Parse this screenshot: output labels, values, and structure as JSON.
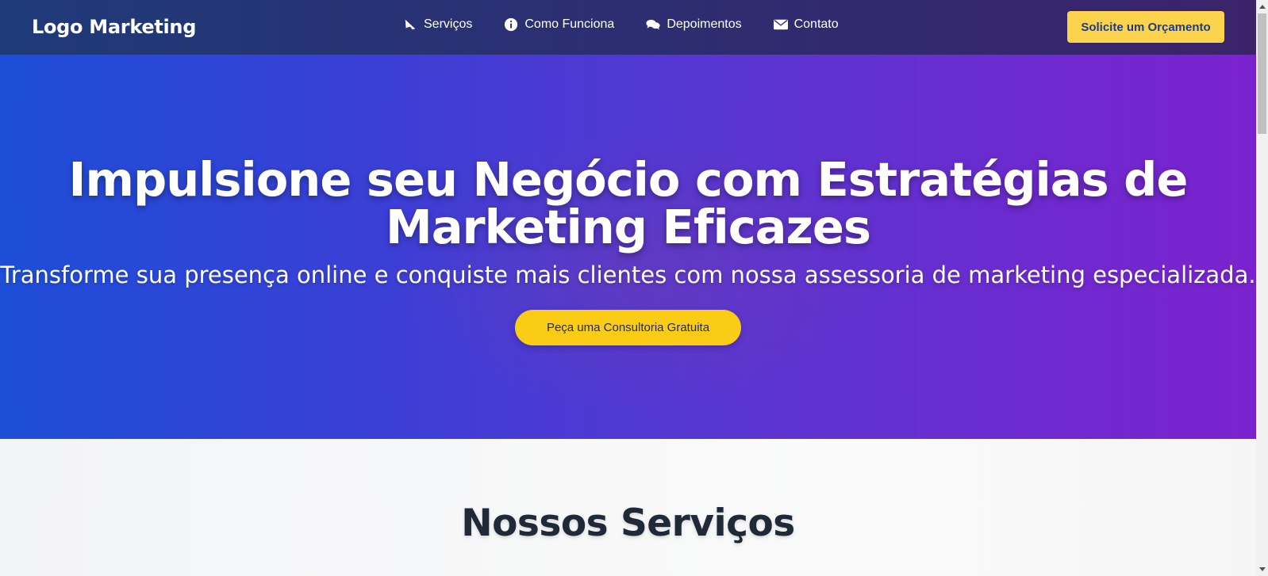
{
  "navbar": {
    "logo": "Logo Marketing",
    "links": [
      {
        "label": "Serviços",
        "icon": "bullhorn-icon"
      },
      {
        "label": "Como Funciona",
        "icon": "info-circle-icon"
      },
      {
        "label": "Depoimentos",
        "icon": "comments-icon"
      },
      {
        "label": "Contato",
        "icon": "envelope-icon"
      }
    ],
    "cta_label": "Solicite um Orçamento"
  },
  "hero": {
    "title": "Impulsione seu Negócio com Estratégias de Marketing Eficazes",
    "subtitle": "Transforme sua presença online e conquiste mais clientes com nossa assessoria de marketing especializada.",
    "button_label": "Peça uma Consultoria Gratuita"
  },
  "services": {
    "title": "Nossos Serviços"
  },
  "colors": {
    "accent_yellow": "#facc15",
    "hero_gradient_start": "#1d4ed8",
    "hero_gradient_end": "#7b22ce",
    "heading_dark": "#1f2937"
  }
}
